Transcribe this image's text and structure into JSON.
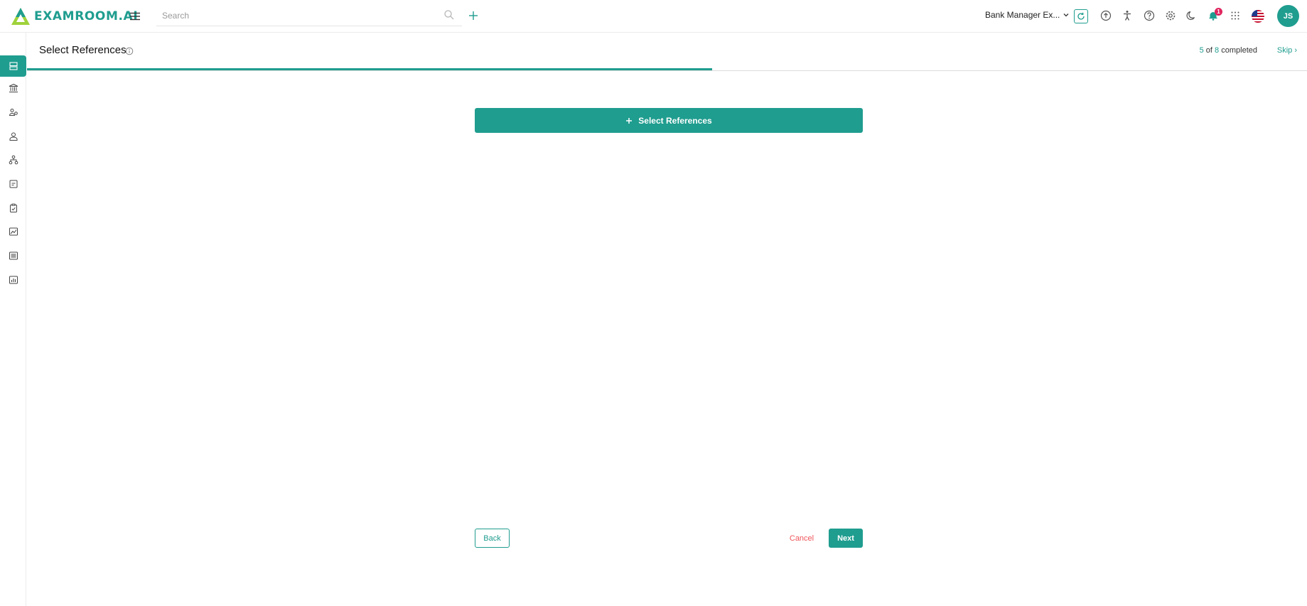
{
  "app": {
    "logo_text": "EXAMROOM.AI"
  },
  "topbar": {
    "search_placeholder": "Search",
    "exam_selector": "Bank Manager Ex...",
    "notification_count": "1",
    "avatar_initials": "JS"
  },
  "sidebar": {
    "items": [
      {
        "icon": "dashboard-icon",
        "active": true
      },
      {
        "icon": "bank-icon",
        "active": false
      },
      {
        "icon": "users-icon",
        "active": false
      },
      {
        "icon": "user-icon",
        "active": false
      },
      {
        "icon": "hierarchy-icon",
        "active": false
      },
      {
        "icon": "document-icon",
        "active": false
      },
      {
        "icon": "clipboard-check-icon",
        "active": false
      },
      {
        "icon": "image-chart-icon",
        "active": false
      },
      {
        "icon": "list-icon",
        "active": false
      },
      {
        "icon": "bar-chart-icon",
        "active": false
      }
    ]
  },
  "step": {
    "title": "Select References",
    "completed": "5",
    "of_label": "of",
    "total": "8",
    "completed_label": "completed",
    "progress_fraction": 0.535,
    "skip_label": "Skip ›"
  },
  "main": {
    "select_button_label": "Select References",
    "back_label": "Back",
    "cancel_label": "Cancel",
    "next_label": "Next"
  },
  "colors": {
    "accent": "#1f9d8f",
    "danger": "#f0555a",
    "badge": "#e0245e"
  }
}
